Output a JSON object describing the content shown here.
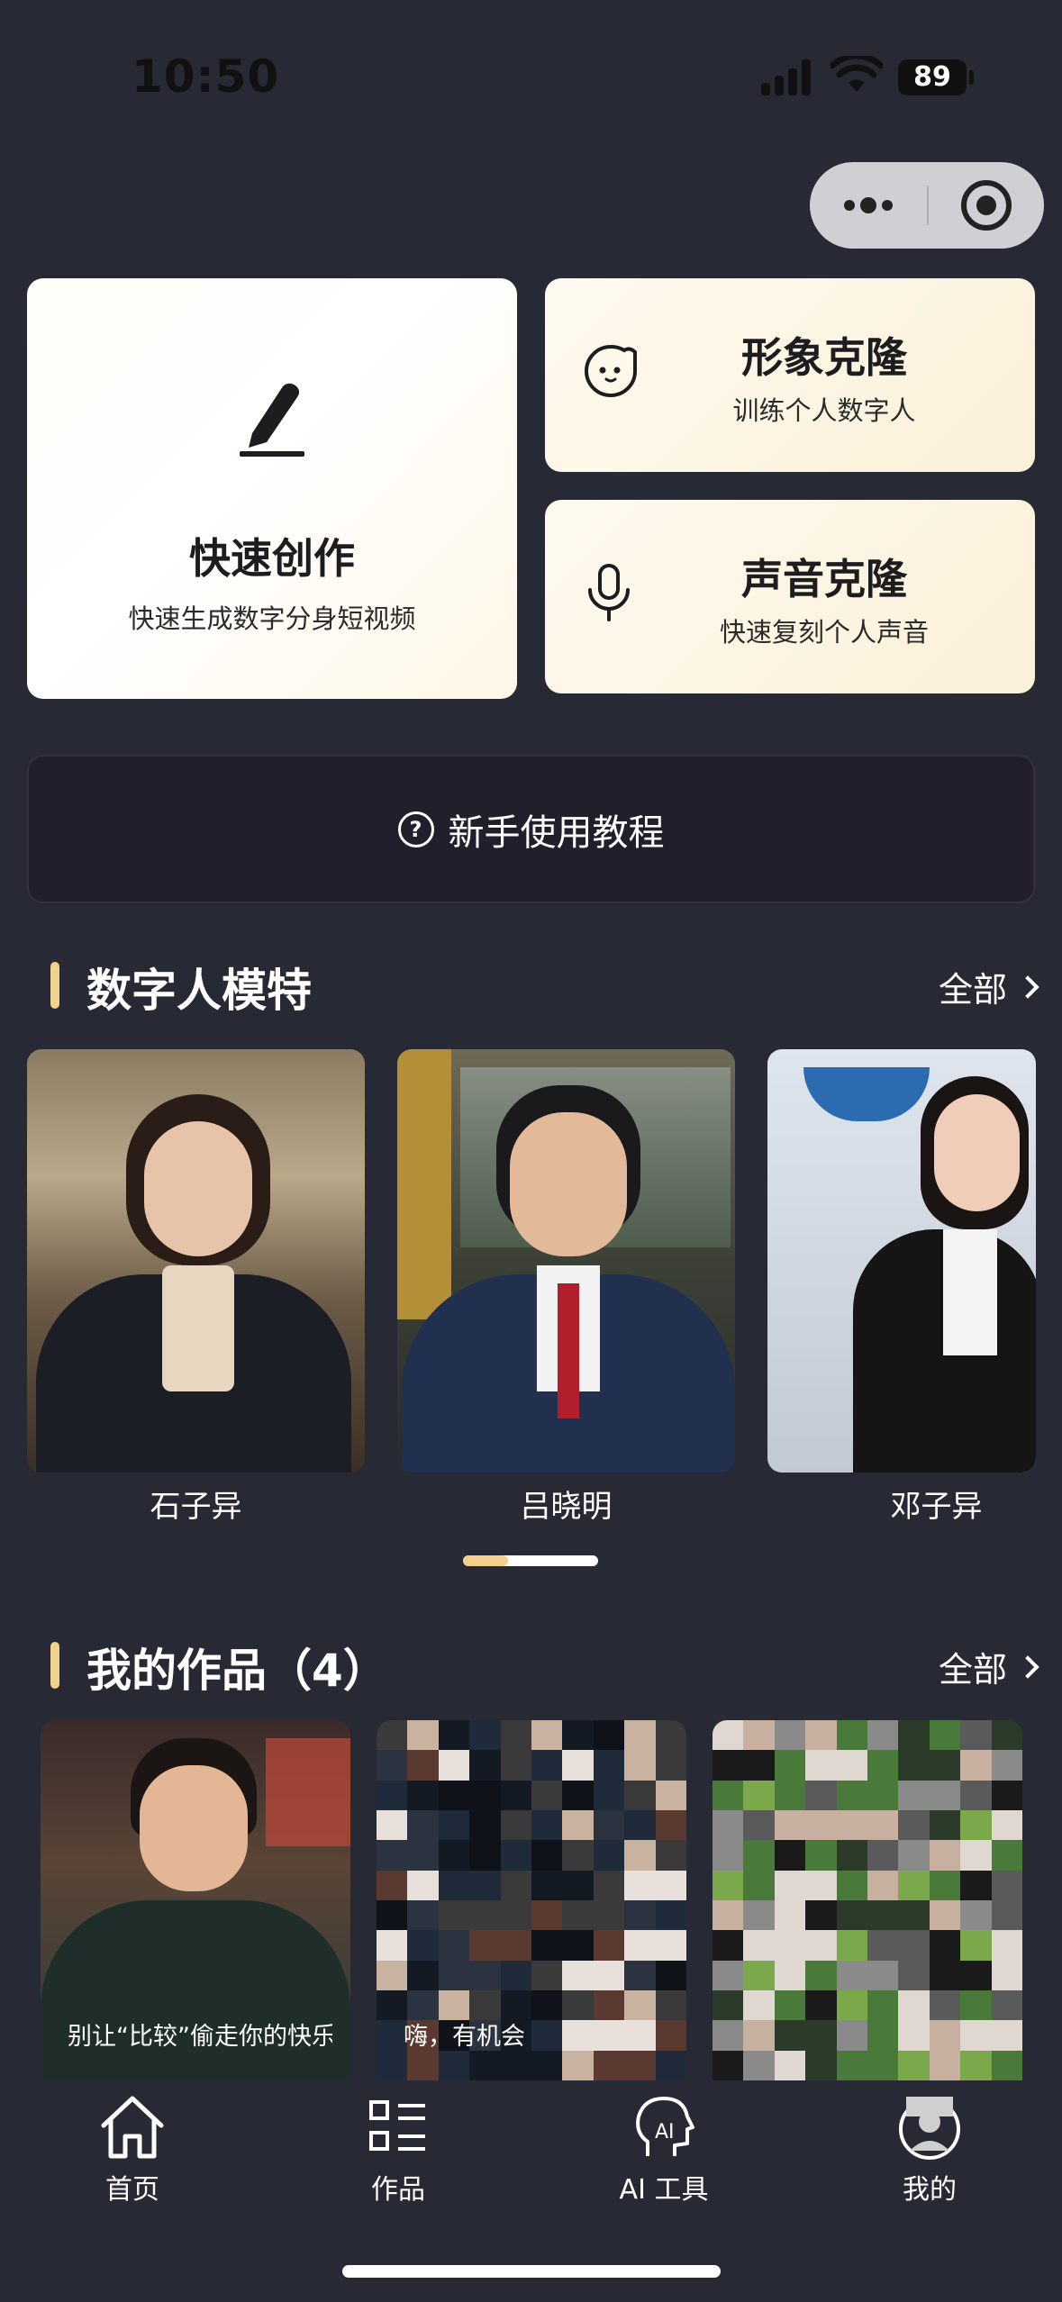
{
  "status_bar": {
    "time": "10:50",
    "battery": "89"
  },
  "cards": {
    "quick_create": {
      "title": "快速创作",
      "subtitle": "快速生成数字分身短视频",
      "icon": "pen-icon"
    },
    "image_clone": {
      "title": "形象克隆",
      "subtitle": "训练个人数字人",
      "icon": "face-icon"
    },
    "voice_clone": {
      "title": "声音克隆",
      "subtitle": "快速复刻个人声音",
      "icon": "mic-icon"
    }
  },
  "tutorial": {
    "label": "新手使用教程",
    "icon": "question-icon"
  },
  "models_section": {
    "title": "数字人模特",
    "all_label": "全部",
    "items": [
      {
        "name": "石子异"
      },
      {
        "name": "吕晓明"
      },
      {
        "name": "邓子异"
      }
    ],
    "scroll_progress": 0.33
  },
  "works_section": {
    "title": "我的作品（4）",
    "all_label": "全部",
    "items": [
      {
        "caption": "别让“比较”偷走你的快乐，每个人的节"
      },
      {
        "caption": "嗨，有机会"
      },
      {
        "caption": ""
      }
    ]
  },
  "tabbar": {
    "items": [
      {
        "label": "首页",
        "icon": "home-icon"
      },
      {
        "label": "作品",
        "icon": "works-grid-icon"
      },
      {
        "label": "AI 工具",
        "icon": "ai-head-icon"
      },
      {
        "label": "我的",
        "icon": "profile-icon"
      }
    ]
  },
  "colors": {
    "background": "#272a35",
    "accent": "#f3d28d",
    "card_cream": "#fbf0d8",
    "tutorial_bg": "#221e2c"
  }
}
